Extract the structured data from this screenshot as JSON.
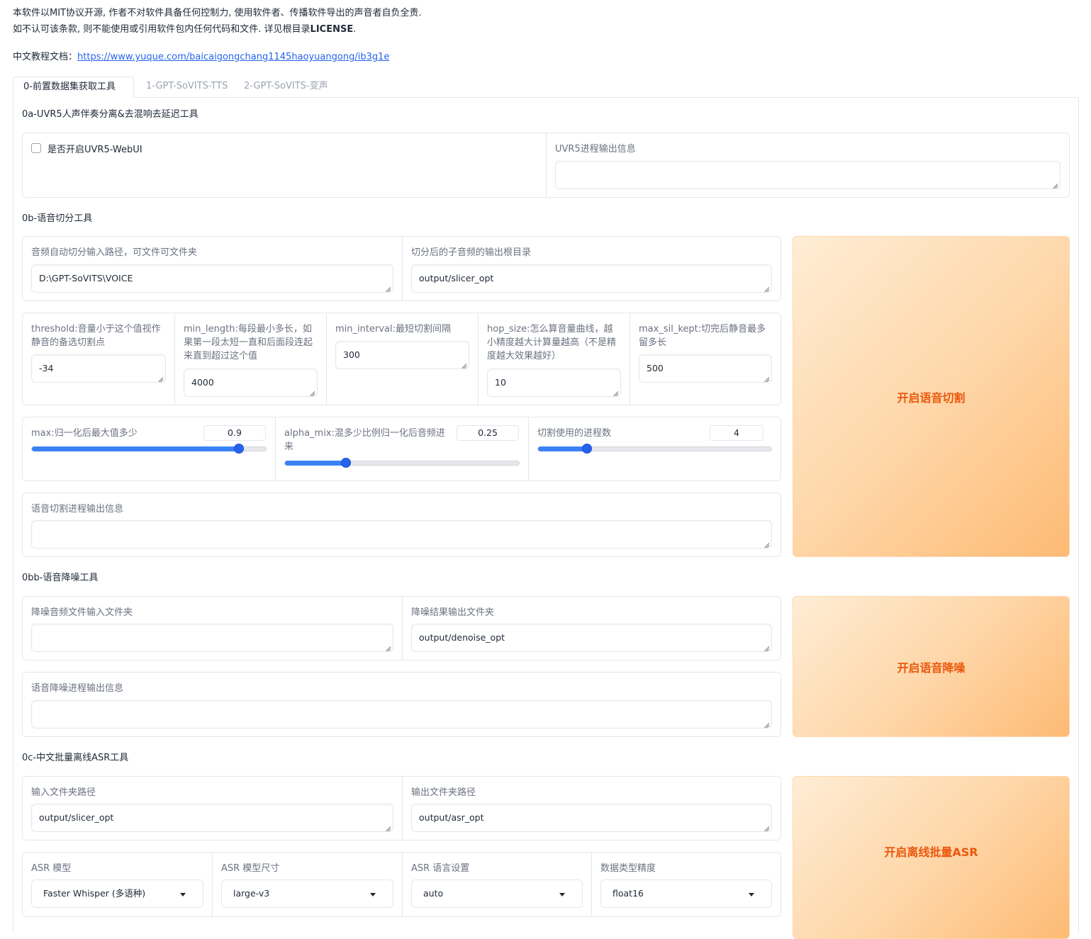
{
  "notice": {
    "line1": "本软件以MIT协议开源, 作者不对软件具备任何控制力, 使用软件者、传播软件导出的声音者自负全责.",
    "line2_prefix": "如不认可该条款, 则不能使用或引用软件包内任何代码和文件. 详见根目录",
    "line2_bold": "LICENSE",
    "line2_suffix": ".",
    "doc_label": "中文教程文档：",
    "doc_link": "https://www.yuque.com/baicaigongchang1145haoyuangong/ib3g1e"
  },
  "tabs": [
    "0-前置数据集获取工具",
    "1-GPT-SoVITS-TTS",
    "2-GPT-SoVITS-变声"
  ],
  "uvr5": {
    "title": "0a-UVR5人声伴奏分离&去混响去延迟工具",
    "checkbox_label": "是否开启UVR5-WebUI",
    "output_label": "UVR5进程输出信息",
    "output_value": ""
  },
  "slicer": {
    "title": "0b-语音切分工具",
    "input_label": "音频自动切分输入路径，可文件可文件夹",
    "input_value": "D:\\GPT-SoVITS\\VOICE",
    "output_label": "切分后的子音频的输出根目录",
    "output_value": "output/slicer_opt",
    "threshold_label": "threshold:音量小于这个值视作静音的备选切割点",
    "threshold_value": "-34",
    "min_length_label": "min_length:每段最小多长，如果第一段太短一直和后面段连起来直到超过这个值",
    "min_length_value": "4000",
    "min_interval_label": "min_interval:最短切割间隔",
    "min_interval_value": "300",
    "hop_size_label": "hop_size:怎么算音量曲线，越小精度越大计算量越高（不是精度越大效果越好）",
    "hop_size_value": "10",
    "max_sil_label": "max_sil_kept:切完后静音最多留多长",
    "max_sil_value": "500",
    "max_label": "max:归一化后最大值多少",
    "max_value": "0.9",
    "max_fraction": 0.885,
    "alpha_label": "alpha_mix:混多少比例归一化后音频进来",
    "alpha_value": "0.25",
    "alpha_fraction": 0.26,
    "proc_label": "切割使用的进程数",
    "proc_value": "4",
    "proc_fraction": 0.21,
    "info_label": "语音切割进程输出信息",
    "info_value": "",
    "button": "开启语音切割"
  },
  "denoise": {
    "title": "0bb-语音降噪工具",
    "input_label": "降噪音频文件输入文件夹",
    "input_value": "",
    "output_label": "降噪结果输出文件夹",
    "output_value": "output/denoise_opt",
    "info_label": "语音降噪进程输出信息",
    "info_value": "",
    "button": "开启语音降噪"
  },
  "asr": {
    "title": "0c-中文批量离线ASR工具",
    "input_label": "输入文件夹路径",
    "input_value": "output/slicer_opt",
    "output_label": "输出文件夹路径",
    "output_value": "output/asr_opt",
    "model_label": "ASR 模型",
    "model_value": "Faster Whisper (多语种)",
    "size_label": "ASR 模型尺寸",
    "size_value": "large-v3",
    "lang_label": "ASR 语言设置",
    "lang_value": "auto",
    "precision_label": "数据类型精度",
    "precision_value": "float16",
    "button": "开启离线批量ASR"
  }
}
